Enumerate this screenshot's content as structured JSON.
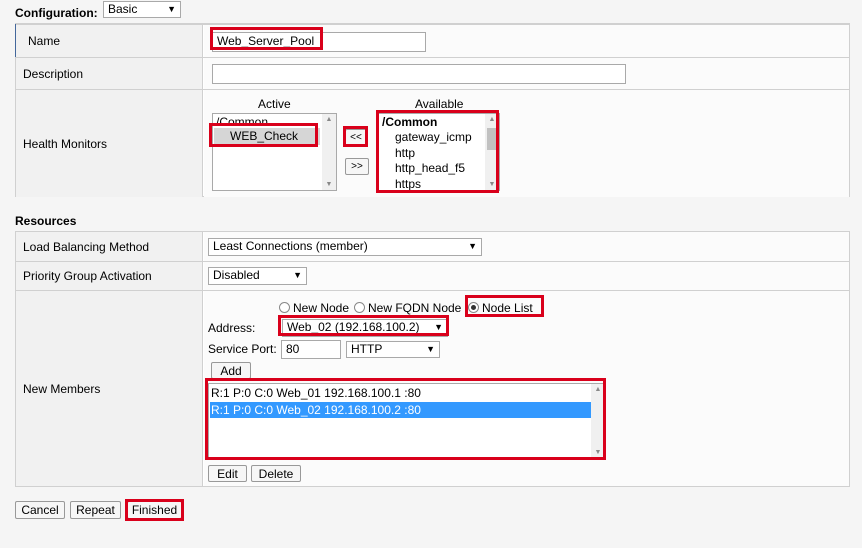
{
  "configuration": {
    "label": "Configuration:",
    "value": "Basic"
  },
  "general": {
    "name_label": "Name",
    "name_value": "Web_Server_Pool",
    "description_label": "Description",
    "description_value": "",
    "health_label": "Health Monitors",
    "active_header": "Active",
    "available_header": "Available",
    "active_group": "/Common",
    "active_items": [
      "WEB_Check"
    ],
    "available_group": "/Common",
    "available_items": [
      "gateway_icmp",
      "http",
      "http_head_f5",
      "https"
    ],
    "move_left": "<<",
    "move_right": ">>"
  },
  "resources": {
    "title": "Resources",
    "lb_label": "Load Balancing Method",
    "lb_value": "Least Connections (member)",
    "pga_label": "Priority Group Activation",
    "pga_value": "Disabled",
    "members_label": "New Members",
    "radio_new_node": "New Node",
    "radio_new_fqdn": "New FQDN Node",
    "radio_node_list": "Node List",
    "address_label": "Address:",
    "address_value": "Web_02 (192.168.100.2)",
    "port_label": "Service Port:",
    "port_value": "80",
    "protocol_value": "HTTP",
    "add_label": "Add",
    "members": [
      "R:1 P:0 C:0 Web_01 192.168.100.1 :80",
      "R:1 P:0 C:0 Web_02 192.168.100.2 :80"
    ],
    "edit_label": "Edit",
    "delete_label": "Delete"
  },
  "actions": {
    "cancel": "Cancel",
    "repeat": "Repeat",
    "finished": "Finished"
  },
  "colors": {
    "highlight": "#d9001b",
    "selection": "#3399ff",
    "accent_bar": "#43679b"
  }
}
